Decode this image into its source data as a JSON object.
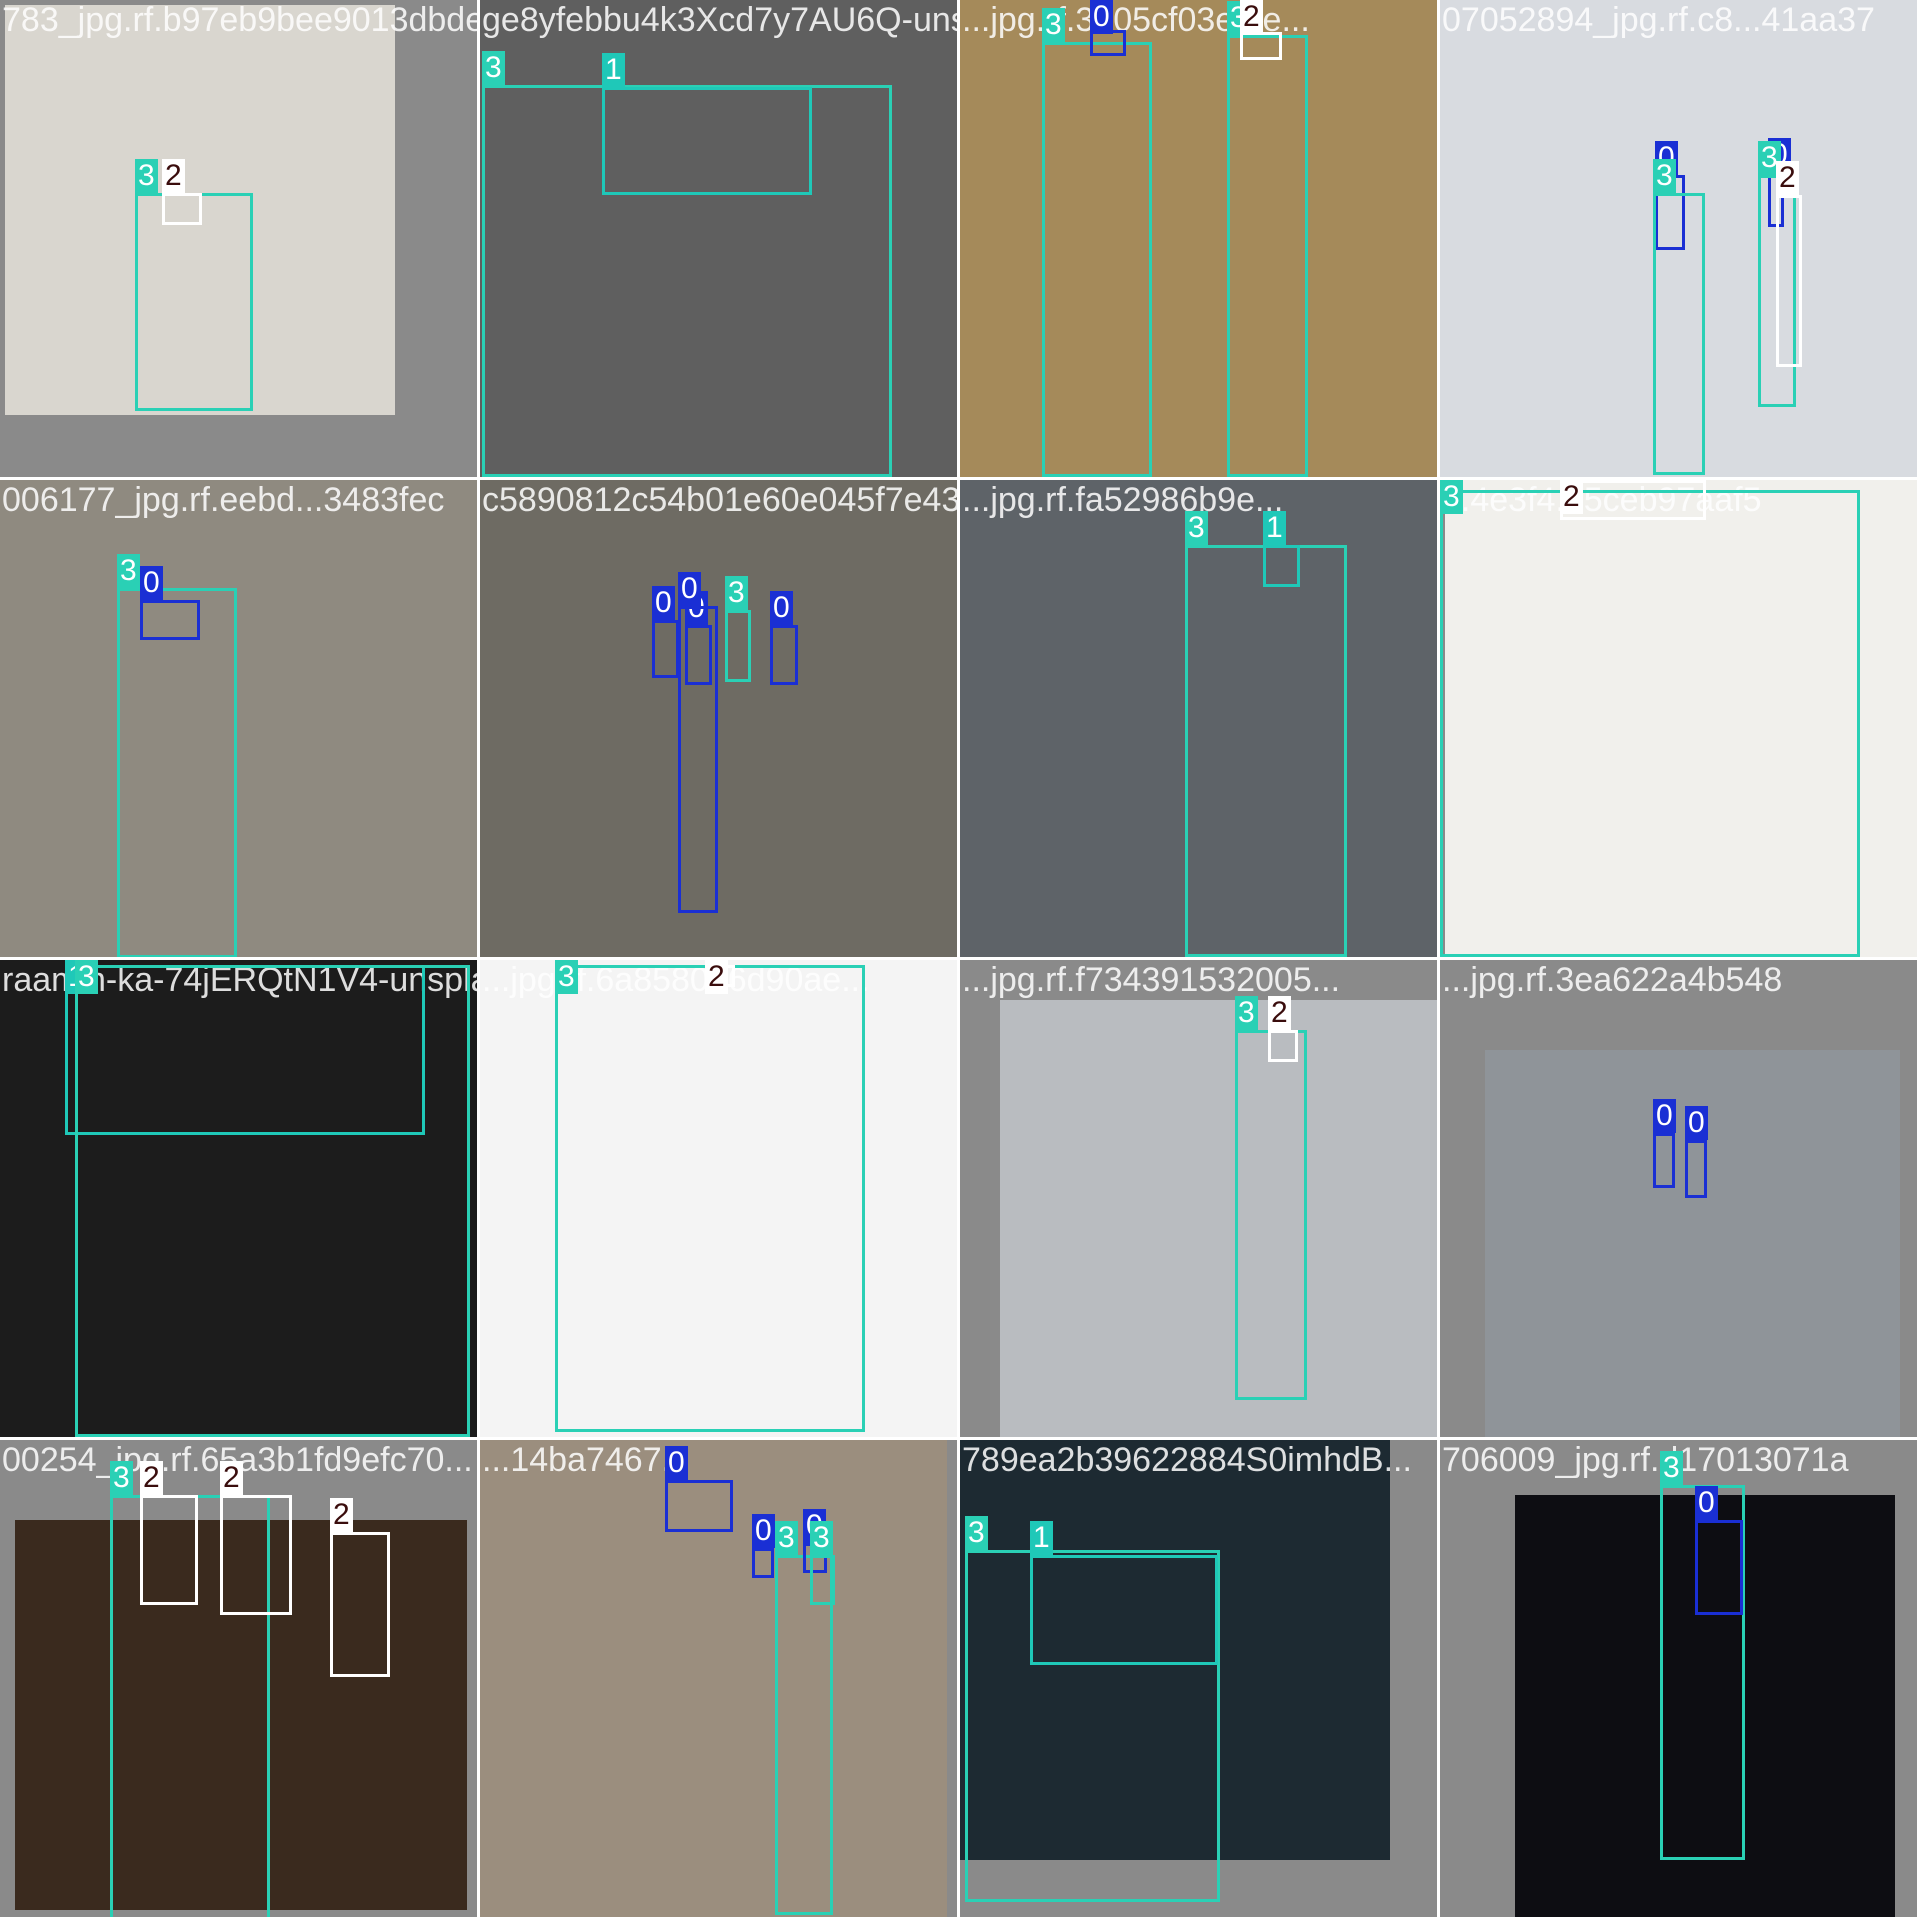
{
  "class_colors": {
    "0": "#1a2fd4",
    "1": "#1fc8b8",
    "2": "#ffffff",
    "3": "#2ad0b5"
  },
  "tiles": [
    {
      "filename": "783_jpg.rf.b97eb9bee9013dbde8c8fe33481c6...",
      "scene_color": "#d9d6cf",
      "boxes": [
        {
          "label": "3",
          "cls": "3"
        },
        {
          "label": "2",
          "cls": "2"
        }
      ]
    },
    {
      "filename": "ge8yfebbu4k3Xcd7y7AU6Q-unsplash_jpg.rf...",
      "scene_color": "#5f5f5f",
      "boxes": [
        {
          "label": "3",
          "cls": "3"
        },
        {
          "label": "1",
          "cls": "1"
        }
      ]
    },
    {
      "filename": "...jpg.rf.3705cf03efde...",
      "scene_color": "#a58a5a",
      "boxes": [
        {
          "label": "3",
          "cls": "3"
        },
        {
          "label": "0",
          "cls": "0"
        },
        {
          "label": "3",
          "cls": "3"
        },
        {
          "label": "2",
          "cls": "2"
        }
      ]
    },
    {
      "filename": "07052894_jpg.rf.c8...41aa37",
      "scene_color": "#d8dbe0",
      "boxes": [
        {
          "label": "0",
          "cls": "0"
        },
        {
          "label": "3",
          "cls": "3"
        },
        {
          "label": "0",
          "cls": "0"
        },
        {
          "label": "3",
          "cls": "3"
        },
        {
          "label": "2",
          "cls": "2"
        }
      ]
    },
    {
      "filename": "006177_jpg.rf.eebd...3483fec",
      "scene_color": "#8f8a80",
      "boxes": [
        {
          "label": "3",
          "cls": "3"
        },
        {
          "label": "0",
          "cls": "0"
        }
      ]
    },
    {
      "filename": "c5890812c54b01e60e045f7e431_jpg.rf.19...",
      "scene_color": "#6e6b63",
      "boxes": [
        {
          "label": "0",
          "cls": "0"
        },
        {
          "label": "0",
          "cls": "0"
        },
        {
          "label": "3",
          "cls": "3"
        },
        {
          "label": "0",
          "cls": "0"
        },
        {
          "label": "0",
          "cls": "0"
        }
      ]
    },
    {
      "filename": "...jpg.rf.fa52986b9e...",
      "scene_color": "#5e6368",
      "boxes": [
        {
          "label": "3",
          "cls": "3"
        },
        {
          "label": "1",
          "cls": "1"
        }
      ]
    },
    {
      "filename": "...4e3f4...5ceb97aaf5",
      "scene_color": "#f1f0ec",
      "boxes": [
        {
          "label": "3",
          "cls": "3"
        },
        {
          "label": "2",
          "cls": "2"
        }
      ]
    },
    {
      "filename": "raamin-ka-74jERQtN1V4-unsplash_jpg.rf...",
      "scene_color": "#1c1c1c",
      "boxes": [
        {
          "label": "1",
          "cls": "1"
        },
        {
          "label": "3",
          "cls": "3"
        }
      ]
    },
    {
      "filename": "...jpg.rf.6a858026d90ae...",
      "scene_color": "#f4f4f4",
      "boxes": [
        {
          "label": "3",
          "cls": "3"
        },
        {
          "label": "2",
          "cls": "2"
        }
      ]
    },
    {
      "filename": "...jpg.rf.f734391532005...",
      "scene_color": "#b9bcc0",
      "boxes": [
        {
          "label": "3",
          "cls": "3"
        },
        {
          "label": "2",
          "cls": "2"
        }
      ]
    },
    {
      "filename": "...jpg.rf.3ea622a4b548",
      "scene_color": "#8f9499",
      "boxes": [
        {
          "label": "0",
          "cls": "0"
        },
        {
          "label": "0",
          "cls": "0"
        }
      ]
    },
    {
      "filename": "00254_jpg.rf.65a3b1fd9efc70...",
      "scene_color": "#3a2a1e",
      "boxes": [
        {
          "label": "3",
          "cls": "3"
        },
        {
          "label": "2",
          "cls": "2"
        },
        {
          "label": "2",
          "cls": "2"
        },
        {
          "label": "2",
          "cls": "2"
        }
      ]
    },
    {
      "filename": "...14ba7467...",
      "scene_color": "#9b8e7e",
      "boxes": [
        {
          "label": "0",
          "cls": "0"
        },
        {
          "label": "0",
          "cls": "0"
        },
        {
          "label": "3",
          "cls": "3"
        },
        {
          "label": "0",
          "cls": "0"
        },
        {
          "label": "3",
          "cls": "3"
        }
      ]
    },
    {
      "filename": "789ea2b39622884S0imhdB...",
      "scene_color": "#1d2a32",
      "boxes": [
        {
          "label": "3",
          "cls": "3"
        },
        {
          "label": "1",
          "cls": "1"
        }
      ]
    },
    {
      "filename": "706009_jpg.rf.d17013071a",
      "scene_color": "#0d0d12",
      "boxes": [
        {
          "label": "3",
          "cls": "3"
        },
        {
          "label": "0",
          "cls": "0"
        }
      ]
    }
  ]
}
